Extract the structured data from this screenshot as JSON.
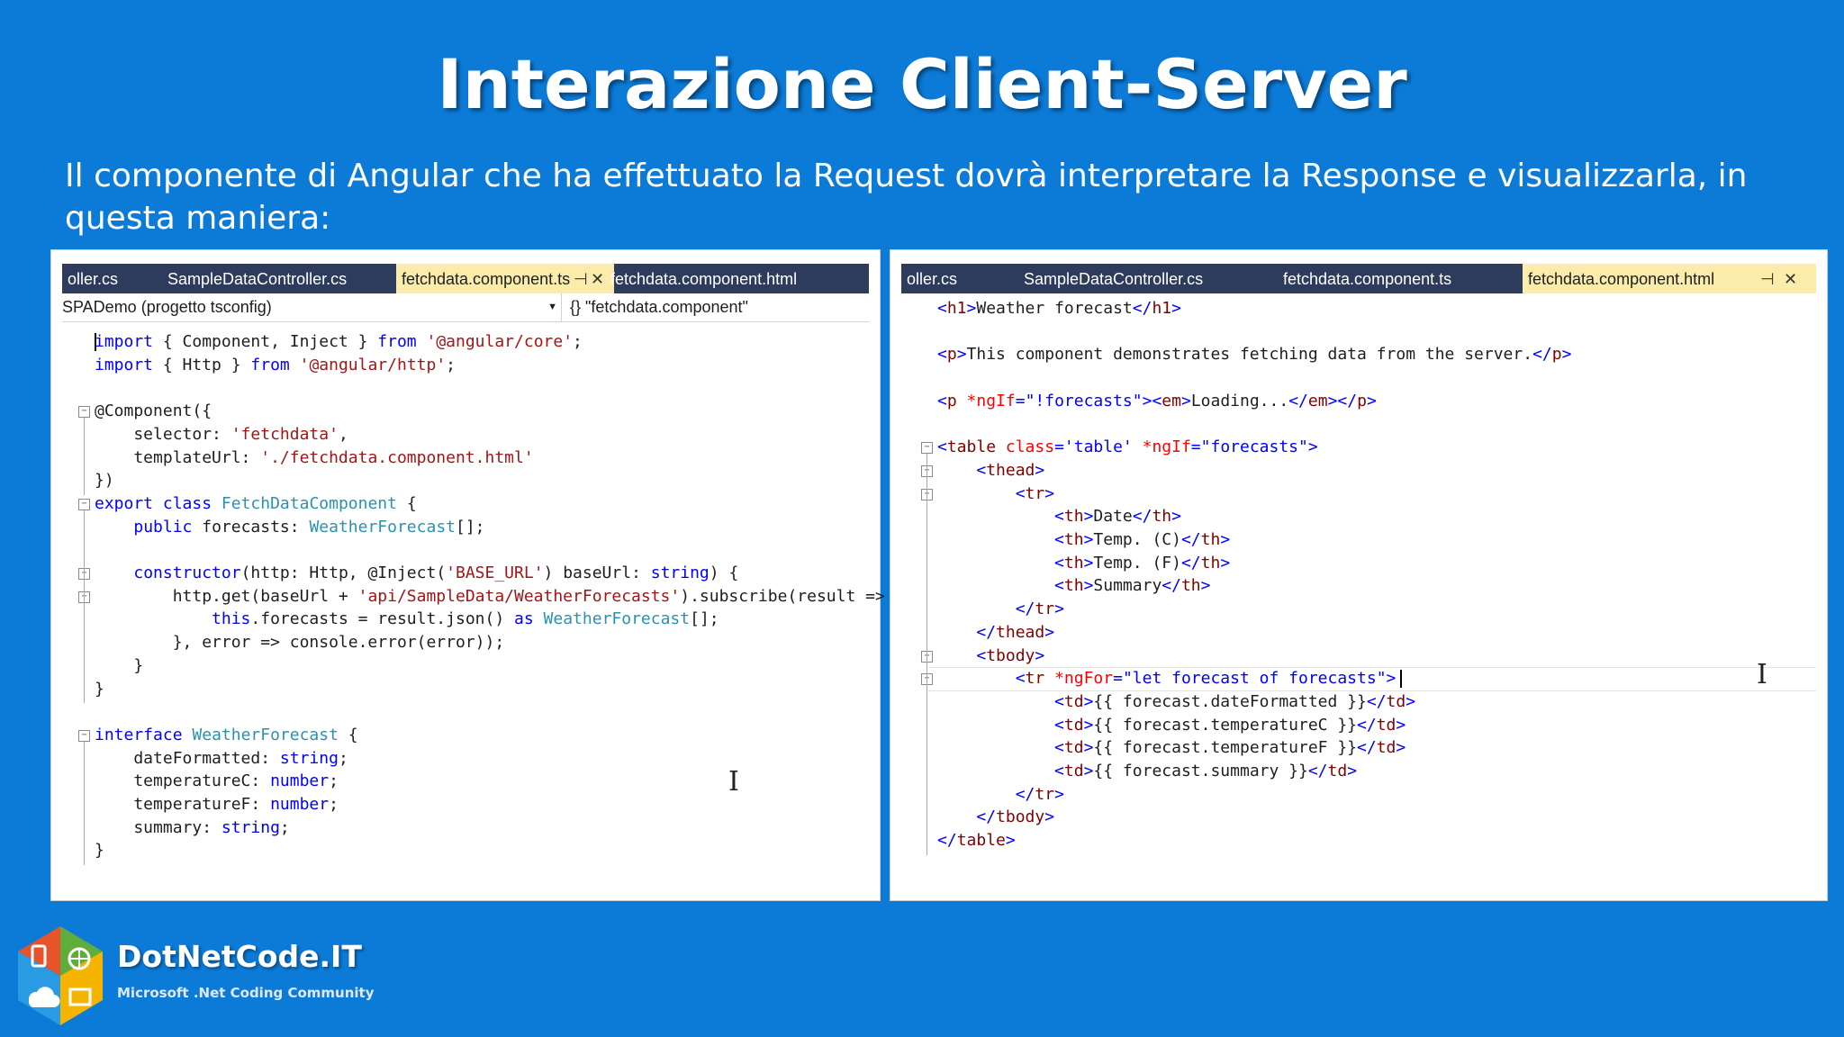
{
  "slide": {
    "title": "Interazione Client-Server",
    "subtitle": "Il componente di Angular che ha effettuato la Request dovrà interpretare la Response e visualizzarla, in questa maniera:"
  },
  "left_editor": {
    "tabs": [
      {
        "label": "oller.cs",
        "active": false
      },
      {
        "label": "SampleDataController.cs",
        "active": false
      },
      {
        "label": "fetchdata.component.ts",
        "active": true
      },
      {
        "label": "fetchdata.component.html",
        "active": false
      }
    ],
    "nav_project": "SPADemo (progetto tsconfig)",
    "nav_symbol": "{} \"fetchdata.component\"",
    "code_lines": [
      "import { Component, Inject } from '@angular/core';",
      "import { Http } from '@angular/http';",
      "",
      "@Component({",
      "    selector: 'fetchdata',",
      "    templateUrl: './fetchdata.component.html'",
      "})",
      "export class FetchDataComponent {",
      "    public forecasts: WeatherForecast[];",
      "",
      "    constructor(http: Http, @Inject('BASE_URL') baseUrl: string) {",
      "        http.get(baseUrl + 'api/SampleData/WeatherForecasts').subscribe(result => {",
      "            this.forecasts = result.json() as WeatherForecast[];",
      "        }, error => console.error(error));",
      "    }",
      "}",
      "",
      "interface WeatherForecast {",
      "    dateFormatted: string;",
      "    temperatureC: number;",
      "    temperatureF: number;",
      "    summary: string;",
      "}"
    ]
  },
  "right_editor": {
    "tabs": [
      {
        "label": "oller.cs",
        "active": false
      },
      {
        "label": "SampleDataController.cs",
        "active": false
      },
      {
        "label": "fetchdata.component.ts",
        "active": false
      },
      {
        "label": "fetchdata.component.html",
        "active": true
      }
    ],
    "code_lines": [
      "<h1>Weather forecast</h1>",
      "",
      "<p>This component demonstrates fetching data from the server.</p>",
      "",
      "<p *ngIf=\"!forecasts\"><em>Loading...</em></p>",
      "",
      "<table class='table' *ngIf=\"forecasts\">",
      "    <thead>",
      "        <tr>",
      "            <th>Date</th>",
      "            <th>Temp. (C)</th>",
      "            <th>Temp. (F)</th>",
      "            <th>Summary</th>",
      "        </tr>",
      "    </thead>",
      "    <tbody>",
      "        <tr *ngFor=\"let forecast of forecasts\">",
      "            <td>{{ forecast.dateFormatted }}</td>",
      "            <td>{{ forecast.temperatureC }}</td>",
      "            <td>{{ forecast.temperatureF }}</td>",
      "            <td>{{ forecast.summary }}</td>",
      "        </tr>",
      "    </tbody>",
      "</table>"
    ]
  },
  "branding": {
    "name": "DotNetCode.IT",
    "tagline": "Microsoft .Net Coding Community"
  }
}
